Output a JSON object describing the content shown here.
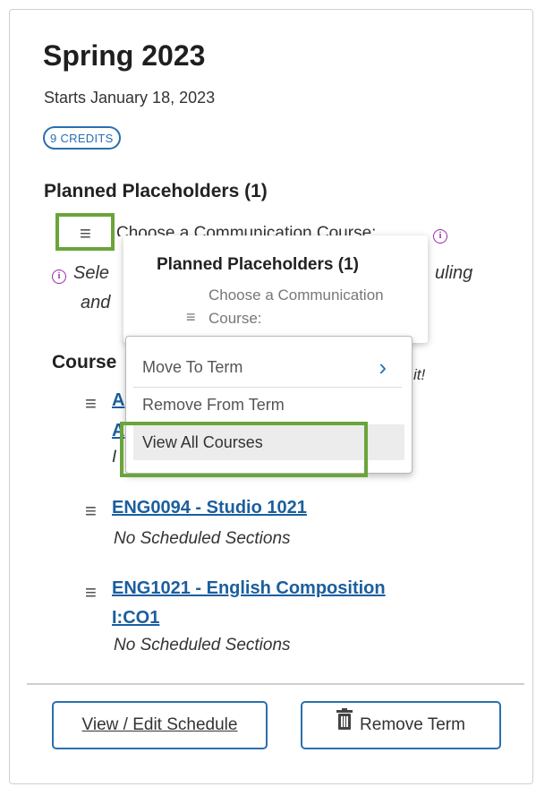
{
  "term": {
    "title": "Spring 2023",
    "start": "Starts January 18, 2023",
    "credits": "9 CREDITS"
  },
  "placeholders": {
    "heading": "Planned Placeholders (1)",
    "item": "Choose a Communication Course:",
    "note_start": "Sele",
    "note_end": "uling",
    "note_line2": "and",
    "info_glyph": "i"
  },
  "tooltip": {
    "heading": "Planned Placeholders (1)",
    "item_line1": "Choose a Communication",
    "item_line2": "Course:"
  },
  "context_menu": {
    "move_to_term": "Move To Term",
    "remove_from_term": "Remove From Term",
    "view_all_courses": "View All Courses",
    "chevron": "›"
  },
  "courses": {
    "heading": "Course",
    "partial_link_a": "A",
    "partial_link_b": "A",
    "partial_text": "I",
    "partial_italic_end": "it!",
    "items": [
      {
        "title": "ENG0094 - Studio 1021",
        "status": "No Scheduled Sections"
      },
      {
        "title_line1": "ENG1021 - English Composition",
        "title_line2": "I:CO1",
        "status": "No Scheduled Sections"
      }
    ]
  },
  "actions": {
    "view_edit": "View / Edit Schedule",
    "remove_term": "Remove Term"
  },
  "glyphs": {
    "hamburger": "≡",
    "trash": "🗑"
  }
}
